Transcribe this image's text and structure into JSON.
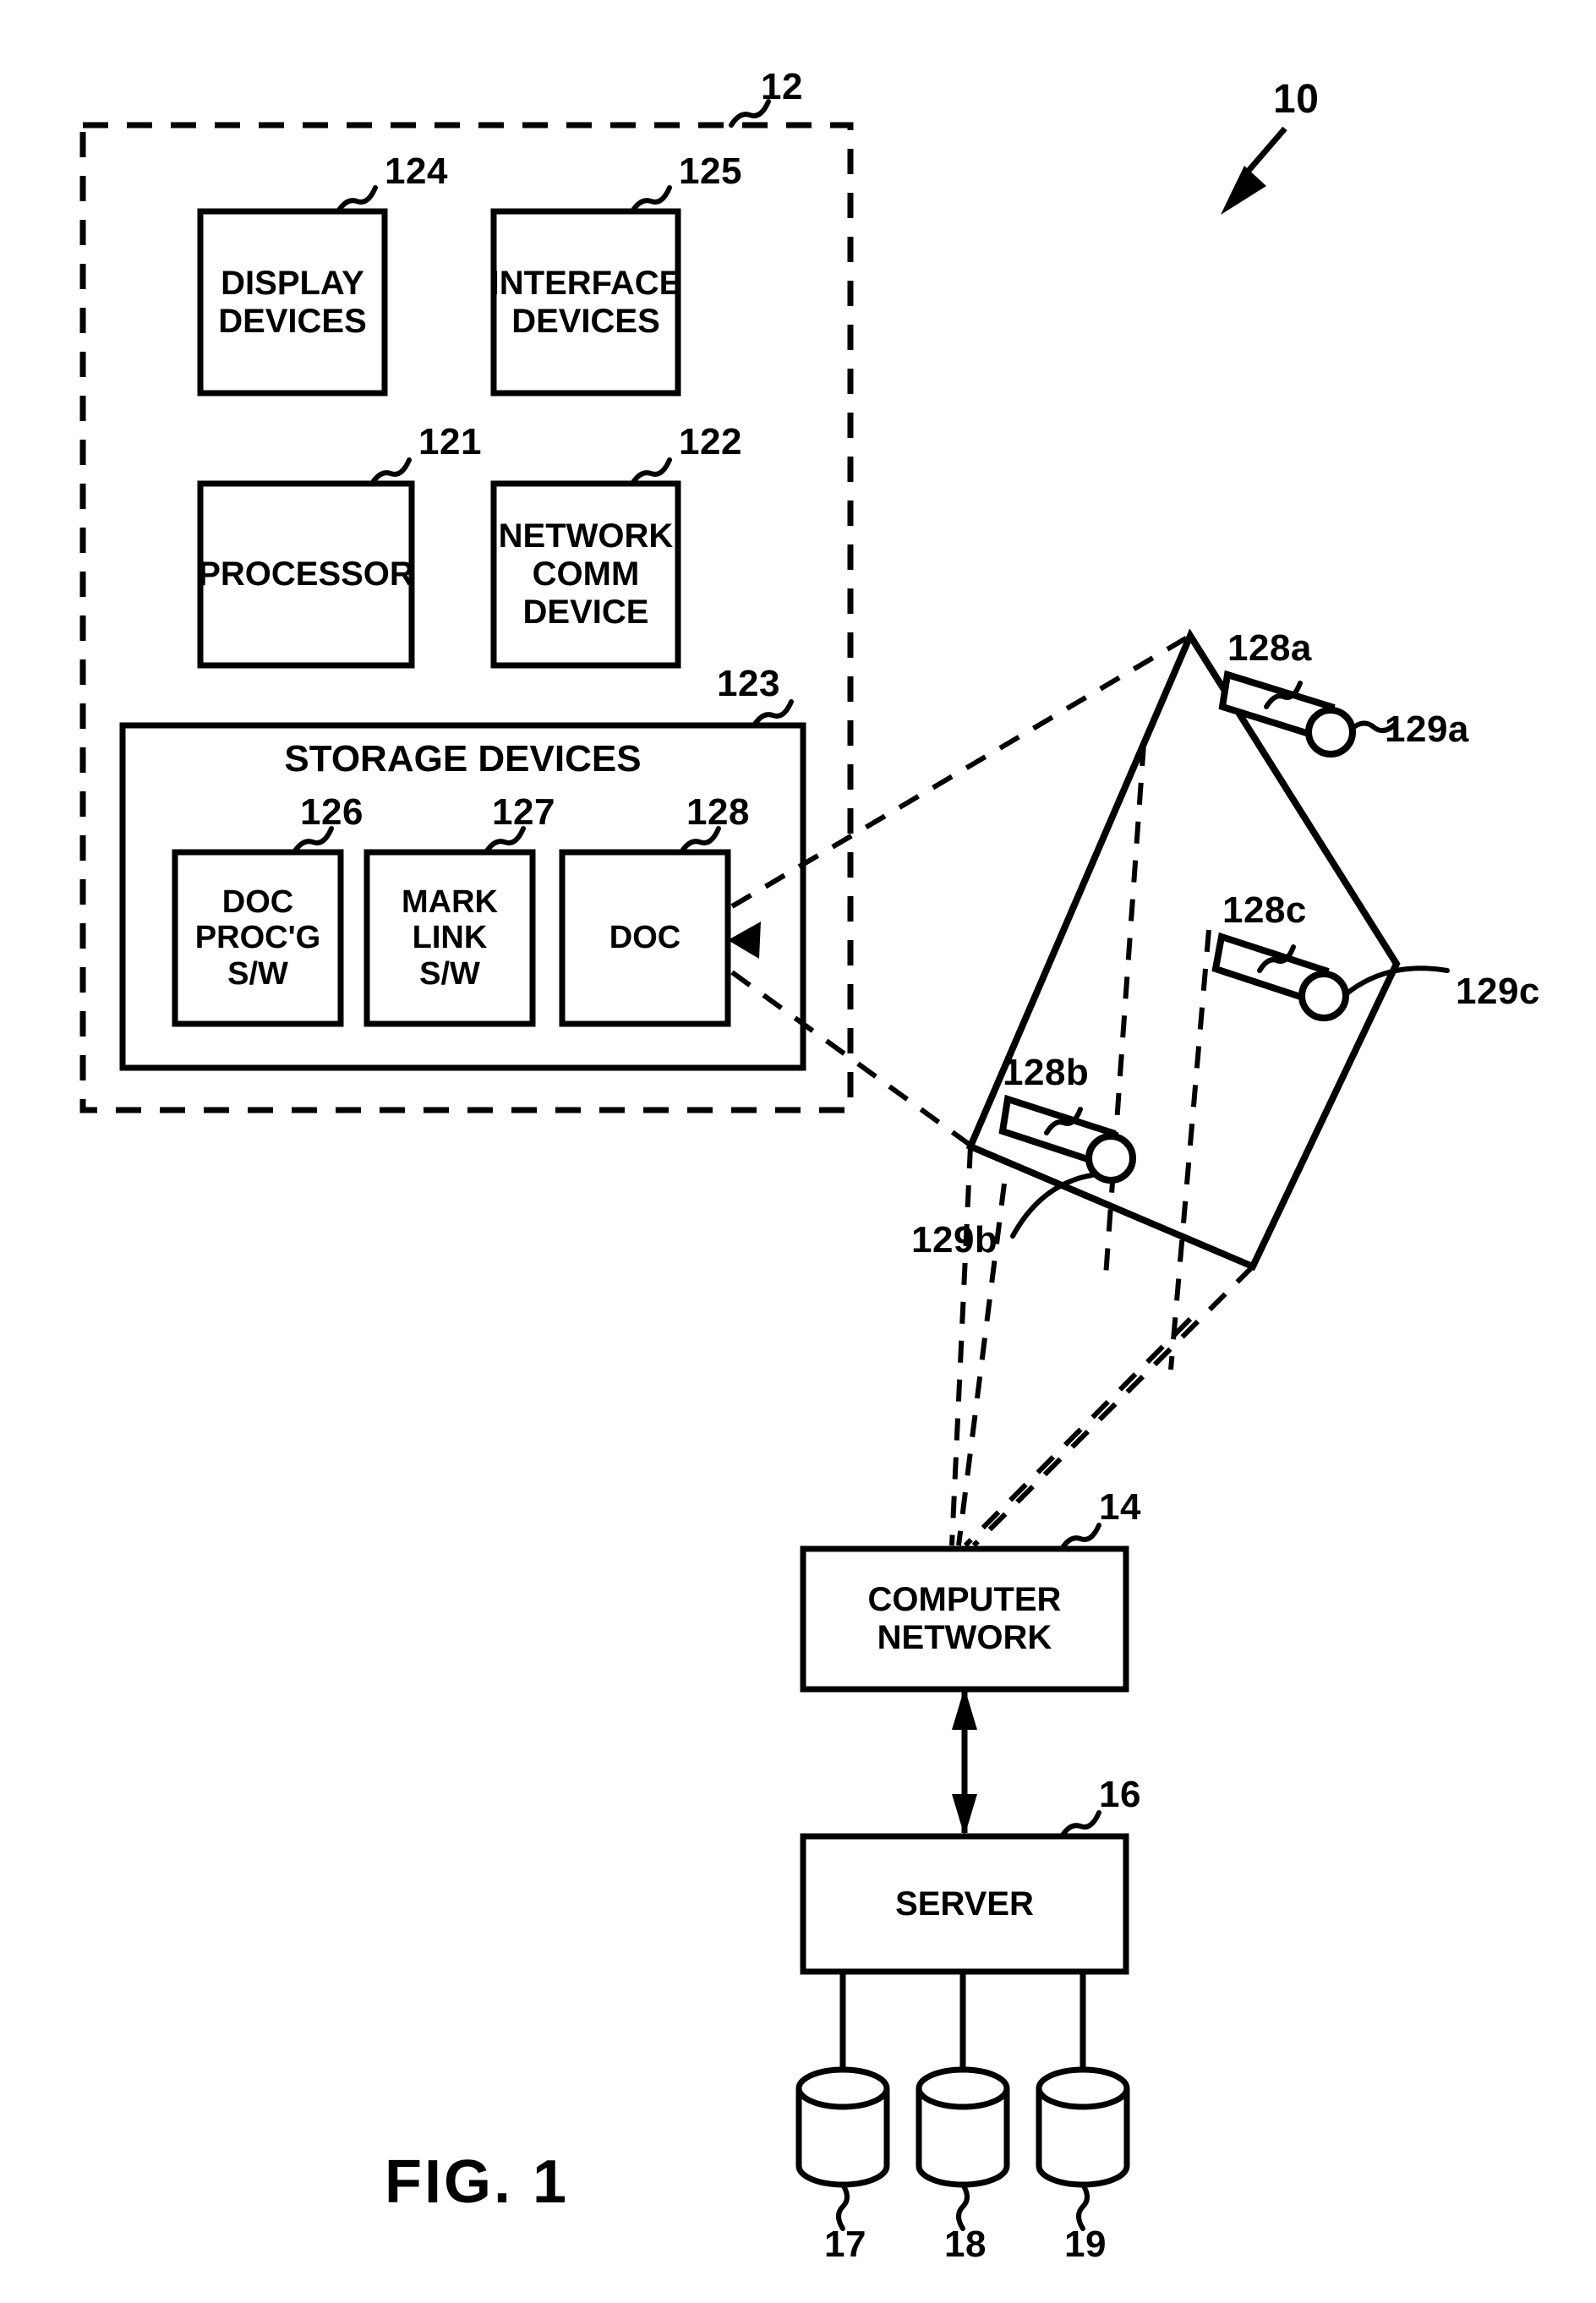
{
  "figure": {
    "title": "FIG. 1",
    "system_ref": "10",
    "client_ref": "12"
  },
  "client": {
    "ref": "12",
    "boxes": [
      {
        "id": "display-devices",
        "ref": "124",
        "label": "DISPLAY\nDEVICES"
      },
      {
        "id": "interface-devices",
        "ref": "125",
        "label": "INTERFACE\nDEVICES"
      },
      {
        "id": "processor",
        "ref": "121",
        "label": "PROCESSOR"
      },
      {
        "id": "network-comm-device",
        "ref": "122",
        "label": "NETWORK\nCOMM\nDEVICE"
      }
    ],
    "storage": {
      "ref": "123",
      "label": "STORAGE  DEVICES",
      "items": [
        {
          "id": "doc-processing-sw",
          "ref": "126",
          "label": "DOC\nPROC'G\nS/W"
        },
        {
          "id": "mark-link-sw",
          "ref": "127",
          "label": "MARK\nLINK\nS/W"
        },
        {
          "id": "doc",
          "ref": "128",
          "label": "DOC"
        }
      ]
    }
  },
  "document_detail": {
    "marks": [
      {
        "id": "mark-a",
        "ref": "128a"
      },
      {
        "id": "mark-b",
        "ref": "128b"
      },
      {
        "id": "mark-c",
        "ref": "128c"
      }
    ],
    "links": [
      {
        "id": "link-a",
        "ref": "129a"
      },
      {
        "id": "link-b",
        "ref": "129b"
      },
      {
        "id": "link-c",
        "ref": "129c"
      }
    ]
  },
  "network": {
    "ref": "14",
    "label": "COMPUTER\nNETWORK"
  },
  "server": {
    "ref": "16",
    "label": "SERVER",
    "databases": [
      {
        "id": "db-17",
        "ref": "17"
      },
      {
        "id": "db-18",
        "ref": "18"
      },
      {
        "id": "db-19",
        "ref": "19"
      }
    ]
  },
  "colors": {
    "ink": "#000000",
    "paper": "#ffffff"
  }
}
